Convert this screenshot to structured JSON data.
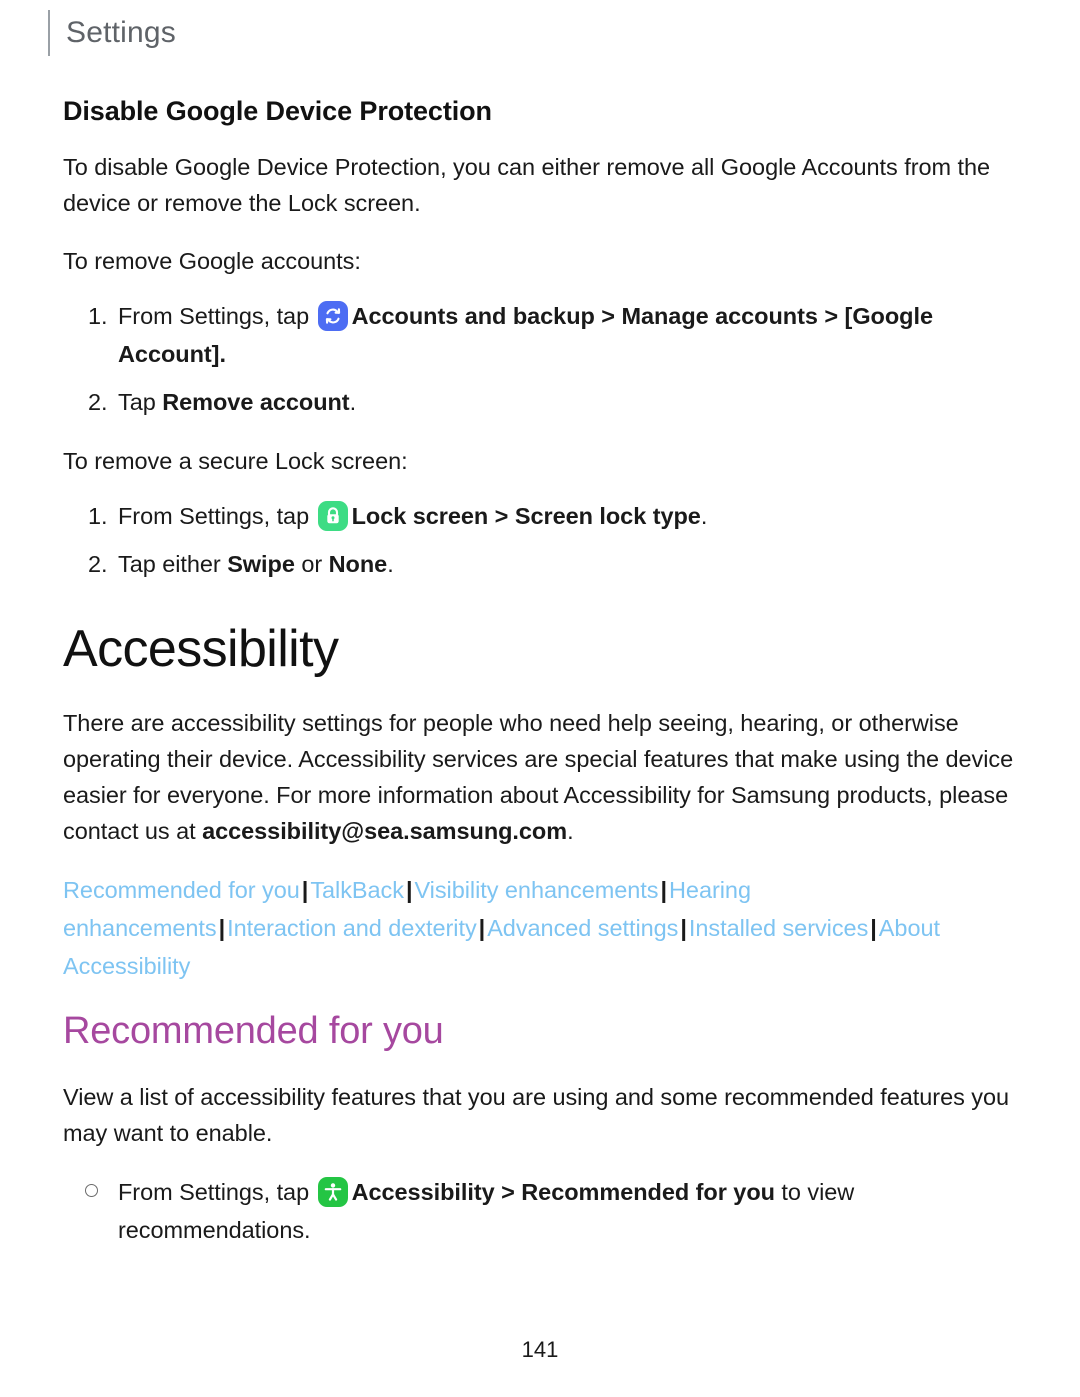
{
  "header": {
    "title": "Settings"
  },
  "sections": {
    "device_protection": {
      "heading": "Disable Google Device Protection",
      "intro": "To disable Google Device Protection, you can either remove all Google Accounts from the device or remove the Lock screen.",
      "accounts_lead": "To remove Google accounts:",
      "accounts_steps": [
        {
          "number": "1.",
          "prefix": "From Settings, tap ",
          "icon": "sync-accounts-icon",
          "icon_color": "#4d6df3",
          "bold_1": "Accounts and backup",
          "chevron_1": " > ",
          "bold_2": "Manage accounts",
          "chevron_2": " > ",
          "bold_3": "[Google Account]",
          "suffix": "."
        },
        {
          "number": "2.",
          "prefix": "Tap ",
          "bold_1": "Remove account",
          "suffix": "."
        }
      ],
      "lock_lead": "To remove a secure Lock screen:",
      "lock_steps": [
        {
          "number": "1.",
          "prefix": "From Settings, tap ",
          "icon": "lock-screen-icon",
          "icon_color": "#3ddc84",
          "bold_1": "Lock screen",
          "chevron_1": " > ",
          "bold_2": "Screen lock type",
          "suffix": "."
        },
        {
          "number": "2.",
          "prefix": "Tap either ",
          "bold_1": "Swipe",
          "middle": " or ",
          "bold_2": "None",
          "suffix": "."
        }
      ]
    },
    "accessibility": {
      "heading": "Accessibility",
      "intro_part_1": "There are accessibility settings for people who need help seeing, hearing, or otherwise operating their device. Accessibility services are special features that make using the device easier for everyone. For more information about Accessibility for Samsung products, please contact us at ",
      "contact_email": "accessibility@sea.samsung.com",
      "intro_part_2": ".",
      "links": [
        "Recommended for you",
        "TalkBack",
        "Visibility enhancements",
        "Hearing enhancements",
        "Interaction and dexterity",
        "Advanced settings",
        "Installed services",
        "About Accessibility"
      ],
      "link_separator": "|",
      "link_color": "#7ec4f2"
    },
    "recommended": {
      "heading": "Recommended for you",
      "heading_color": "#a6489f",
      "intro": "View a list of accessibility features that you are using and some recommended features you may want to enable.",
      "steps": [
        {
          "marker": "ring-bullet",
          "prefix": "From Settings, tap ",
          "icon": "accessibility-icon",
          "icon_color": "#24c544",
          "bold_1": "Accessibility",
          "chevron_1": " > ",
          "bold_2": "Recommended for you",
          "suffix": " to view recommendations."
        }
      ]
    }
  },
  "footer": {
    "page_number": "141"
  }
}
